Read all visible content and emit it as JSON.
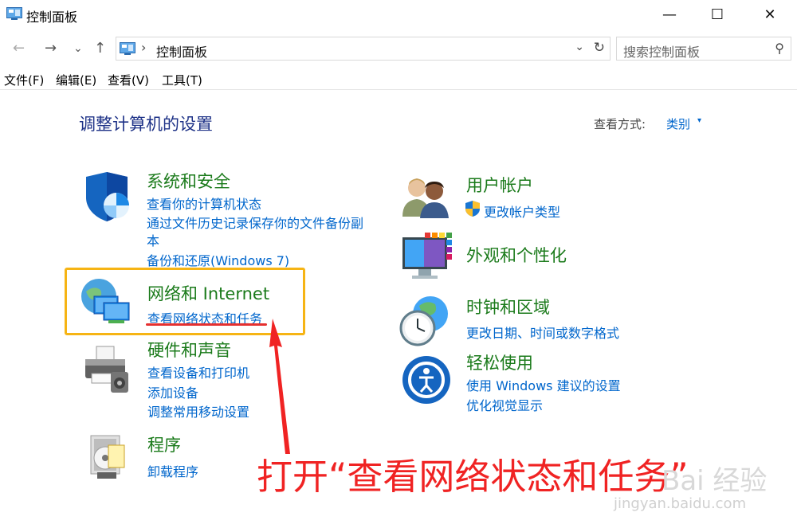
{
  "window": {
    "title": "控制面板",
    "minimize": "—",
    "maximize": "☐",
    "close": "✕"
  },
  "nav": {
    "back": "←",
    "forward": "→",
    "recent": "⌄",
    "up": "↑"
  },
  "address": {
    "separator": "›",
    "path": "控制面板",
    "dropdown": "⌄",
    "refresh": "↻"
  },
  "search": {
    "placeholder": "搜索控制面板",
    "icon": "⚲"
  },
  "menu": [
    "文件(F)",
    "编辑(E)",
    "查看(V)",
    "工具(T)"
  ],
  "header": {
    "title": "调整计算机的设置",
    "view_by_label": "查看方式:",
    "view_by_value": "类别",
    "view_by_caret": "▾"
  },
  "categories_left": [
    {
      "title": "系统和安全",
      "links": [
        "查看你的计算机状态",
        "通过文件历史记录保存你的文件备份副",
        "本",
        "备份和还原(Windows 7)"
      ]
    },
    {
      "title": "网络和 Internet",
      "links": [
        "查看网络状态和任务"
      ]
    },
    {
      "title": "硬件和声音",
      "links": [
        "查看设备和打印机",
        "添加设备",
        "调整常用移动设置"
      ]
    },
    {
      "title": "程序",
      "links": [
        "卸载程序"
      ]
    }
  ],
  "categories_right": [
    {
      "title": "用户帐户",
      "links": [
        "更改帐户类型"
      ]
    },
    {
      "title": "外观和个性化",
      "links": []
    },
    {
      "title": "时钟和区域",
      "links": [
        "更改日期、时间或数字格式"
      ]
    },
    {
      "title": "轻松使用",
      "links": [
        "使用 Windows 建议的设置",
        "优化视觉显示"
      ]
    }
  ],
  "annotation": {
    "text": "打开“查看网络状态和任务”",
    "highlight_color": "#f6b414",
    "arrow_color": "#f02323"
  },
  "watermark": {
    "text": "Bai 经验",
    "url": "jingyan.baidu.com"
  },
  "colors": {
    "heading": "#1e3287",
    "category_title": "#1a7a1a",
    "link": "#0066cc"
  }
}
